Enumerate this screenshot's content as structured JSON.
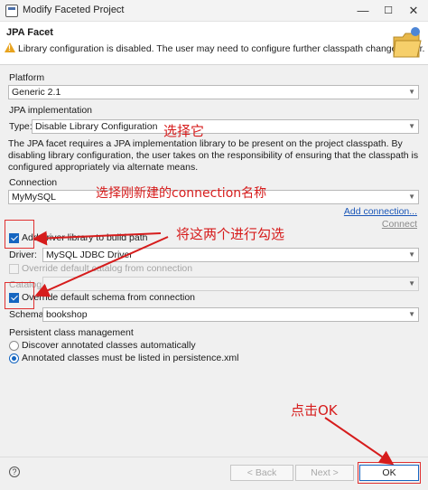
{
  "window": {
    "title": "Modify Faceted Project",
    "controls": {
      "minimize": "—",
      "maximize": "☐",
      "close": "✕"
    }
  },
  "header": {
    "facet_title": "JPA Facet",
    "warning": "Library configuration is disabled. The user may need to configure further classpath changes later."
  },
  "platform": {
    "label": "Platform",
    "value": "Generic 2.1"
  },
  "jpa_impl": {
    "label": "JPA implementation",
    "type_label": "Type:",
    "type_value": "Disable Library Configuration",
    "description": "The JPA facet requires a JPA implementation library to be present on the project classpath. By disabling library configuration, the user takes on the responsibility of ensuring that the classpath is configured appropriately via alternate means."
  },
  "connection": {
    "label": "Connection",
    "value": "MyMySQL",
    "add_link": "Add connection...",
    "connect_link": "Connect",
    "add_driver_label": "Add driver library to build path",
    "add_driver_checked": true,
    "driver_label": "Driver:",
    "driver_value": "MySQL JDBC Driver",
    "override_catalog_label": "Override default catalog from connection",
    "catalog_label": "Catalog:",
    "override_schema_label": "Override default schema from connection",
    "override_schema_checked": true,
    "schema_label": "Schema:",
    "schema_value": "bookshop"
  },
  "persistent": {
    "label": "Persistent class management",
    "option1": "Discover annotated classes automatically",
    "option2": "Annotated classes must be listed in persistence.xml",
    "selected": "option2"
  },
  "footer": {
    "help": "?",
    "back": "< Back",
    "next": "Next >",
    "ok": "OK"
  },
  "annotations": {
    "select_it": "选择它",
    "select_connection": "选择刚新建的connection名称",
    "check_both": "将这两个进行勾选",
    "click_ok": "点击OK",
    "color": "#d61c1c"
  }
}
